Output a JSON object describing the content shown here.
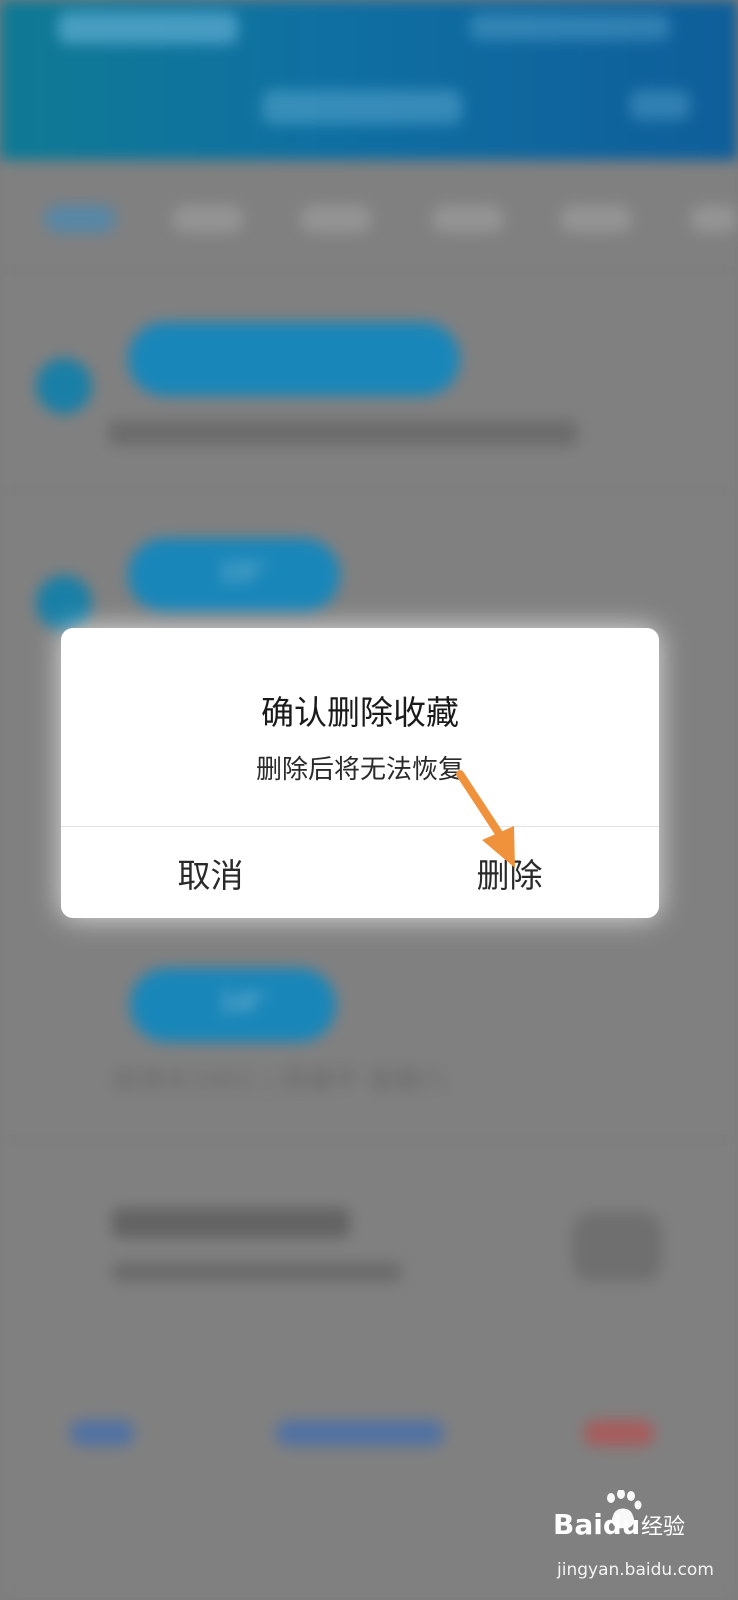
{
  "dialog": {
    "title": "确认删除收藏",
    "message": "删除后将无法恢复",
    "cancel_label": "取消",
    "delete_label": "删除"
  },
  "background": {
    "voice_items": [
      {
        "duration": "15\""
      },
      {
        "duration": "14\""
      }
    ],
    "meta_text": "给排水1901 | 杨健平  星期六"
  },
  "watermark": {
    "brand": "Bai百度经验",
    "url": "jingyan.baidu.com"
  },
  "colors": {
    "header": "#0f6fa2",
    "bubble": "#1986b9",
    "arrow": "#f0923c",
    "overlay": "#7d7d7d"
  }
}
